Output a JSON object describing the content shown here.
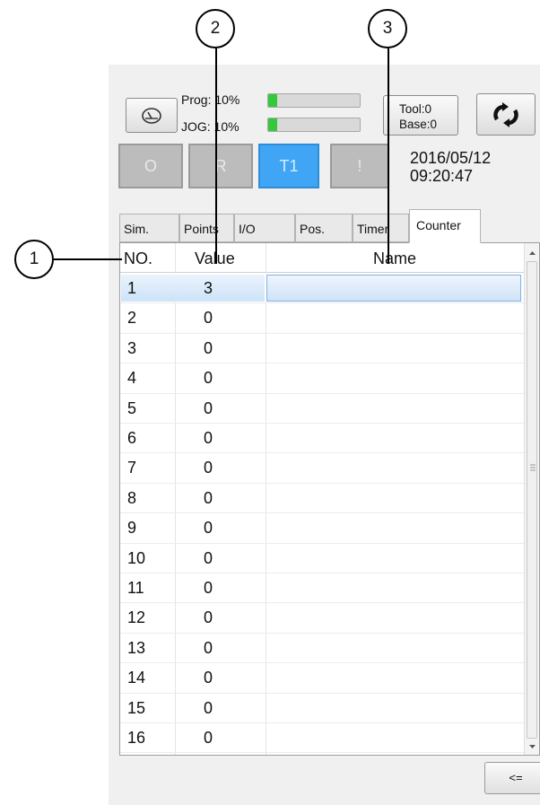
{
  "status": {
    "prog_label": "Prog: 10%",
    "jog_label": "JOG: 10%",
    "prog_percent": 10,
    "jog_percent": 10,
    "tool_label": "Tool:0",
    "base_label": "Base:0"
  },
  "modes": [
    {
      "label": "O",
      "active": false
    },
    {
      "label": "R",
      "active": false
    },
    {
      "label": "T1",
      "active": true
    },
    {
      "label": "!",
      "active": false
    }
  ],
  "datetime": {
    "date": "2016/05/12",
    "time": "09:20:47"
  },
  "tabs": [
    "Sim.",
    "Points",
    "I/O",
    "Pos.",
    "Timer",
    "Counter"
  ],
  "active_tab": "Counter",
  "table": {
    "headers": {
      "no": "NO.",
      "value": "Value",
      "name": "Name"
    },
    "rows": [
      {
        "no": "1",
        "value": "3",
        "name": ""
      },
      {
        "no": "2",
        "value": "0",
        "name": ""
      },
      {
        "no": "3",
        "value": "0",
        "name": ""
      },
      {
        "no": "4",
        "value": "0",
        "name": ""
      },
      {
        "no": "5",
        "value": "0",
        "name": ""
      },
      {
        "no": "6",
        "value": "0",
        "name": ""
      },
      {
        "no": "7",
        "value": "0",
        "name": ""
      },
      {
        "no": "8",
        "value": "0",
        "name": ""
      },
      {
        "no": "9",
        "value": "0",
        "name": ""
      },
      {
        "no": "10",
        "value": "0",
        "name": ""
      },
      {
        "no": "11",
        "value": "0",
        "name": ""
      },
      {
        "no": "12",
        "value": "0",
        "name": ""
      },
      {
        "no": "13",
        "value": "0",
        "name": ""
      },
      {
        "no": "14",
        "value": "0",
        "name": ""
      },
      {
        "no": "15",
        "value": "0",
        "name": ""
      },
      {
        "no": "16",
        "value": "0",
        "name": ""
      }
    ]
  },
  "back_button": "<=",
  "callouts": [
    "1",
    "2",
    "3"
  ],
  "icons": {
    "gauge": "speedometer-icon",
    "refresh": "sync-arrows-icon"
  },
  "colors": {
    "active_mode": "#40a5f4",
    "progress": "#35c83a",
    "selection": "#cde3f8"
  }
}
